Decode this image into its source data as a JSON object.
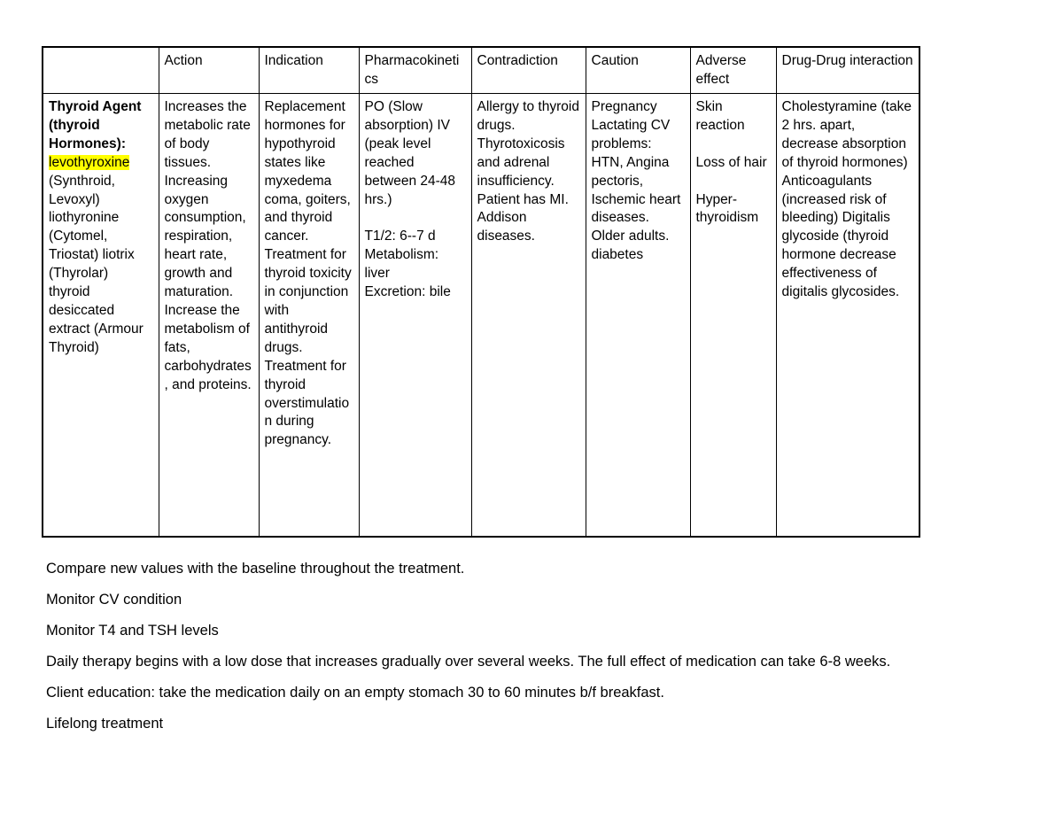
{
  "document": {
    "title": "Thyroid Agent (thyroid Hormones) drug table"
  },
  "table": {
    "columns": [
      {
        "key": "drug",
        "header": ""
      },
      {
        "key": "action",
        "header": "Action"
      },
      {
        "key": "indication",
        "header": "Indication"
      },
      {
        "key": "pharmacokinetics",
        "header": "Pharmacokinetics"
      },
      {
        "key": "contradiction",
        "header": "Contradiction"
      },
      {
        "key": "caution",
        "header": "Caution"
      },
      {
        "key": "adverse_effect",
        "header": "Adverse effect"
      },
      {
        "key": "drug_drug_interaction",
        "header": "Drug-Drug interaction"
      }
    ],
    "row": {
      "drug_title": "Thyroid Agent (thyroid Hormones):",
      "drug_highlighted": "levothyroxine",
      "drug_list": "(Synthroid, Levoxyl) liothyronine (Cytomel, Triostat) liotrix (Thyrolar) thyroid desiccated extract (Armour Thyroid)",
      "action": "Increases the metabolic rate of body tissues. Increasing oxygen consumption, respiration, heart rate, growth and maturation. Increase the metabolism of fats, carbohydrates, and proteins.",
      "indication": "Replacement hormones for hypothyroid states like myxedema coma, goiters, and thyroid cancer. Treatment for thyroid toxicity in conjunction with antithyroid drugs. Treatment for thyroid overstimulation during pregnancy.",
      "pharmacokinetics": "PO (Slow absorption) IV (peak level reached between 24-48 hrs.)\n\nT1/2: 6--7 d\nMetabolism: liver\nExcretion: bile",
      "contradiction": "Allergy to thyroid drugs. Thyrotoxicosis and adrenal insufficiency. Patient has MI.\nAddison diseases.",
      "caution": "Pregnancy Lactating CV problems: HTN, Angina pectoris, Ischemic heart diseases. Older adults. diabetes",
      "adverse_effect": "Skin reaction\n\nLoss of hair\n\nHyper-thyroidism",
      "drug_drug_interaction": "Cholestyramine (take 2 hrs. apart, decrease absorption of thyroid hormones) Anticoagulants (increased risk of bleeding) Digitalis glycoside (thyroid hormone decrease effectiveness of digitalis glycosides."
    }
  },
  "notes": [
    "Compare new values with the baseline throughout the treatment.",
    "Monitor CV condition",
    "Monitor T4 and TSH levels",
    "Daily therapy begins with a low dose that increases gradually over several weeks. The full effect of medication can take 6-8 weeks.",
    "Client education: take the medication daily on an empty stomach 30 to 60 minutes b/f breakfast.",
    "Lifelong treatment"
  ],
  "colors": {
    "highlight": "#ffff00",
    "text": "#000000",
    "border": "#000000",
    "background": "#ffffff"
  }
}
